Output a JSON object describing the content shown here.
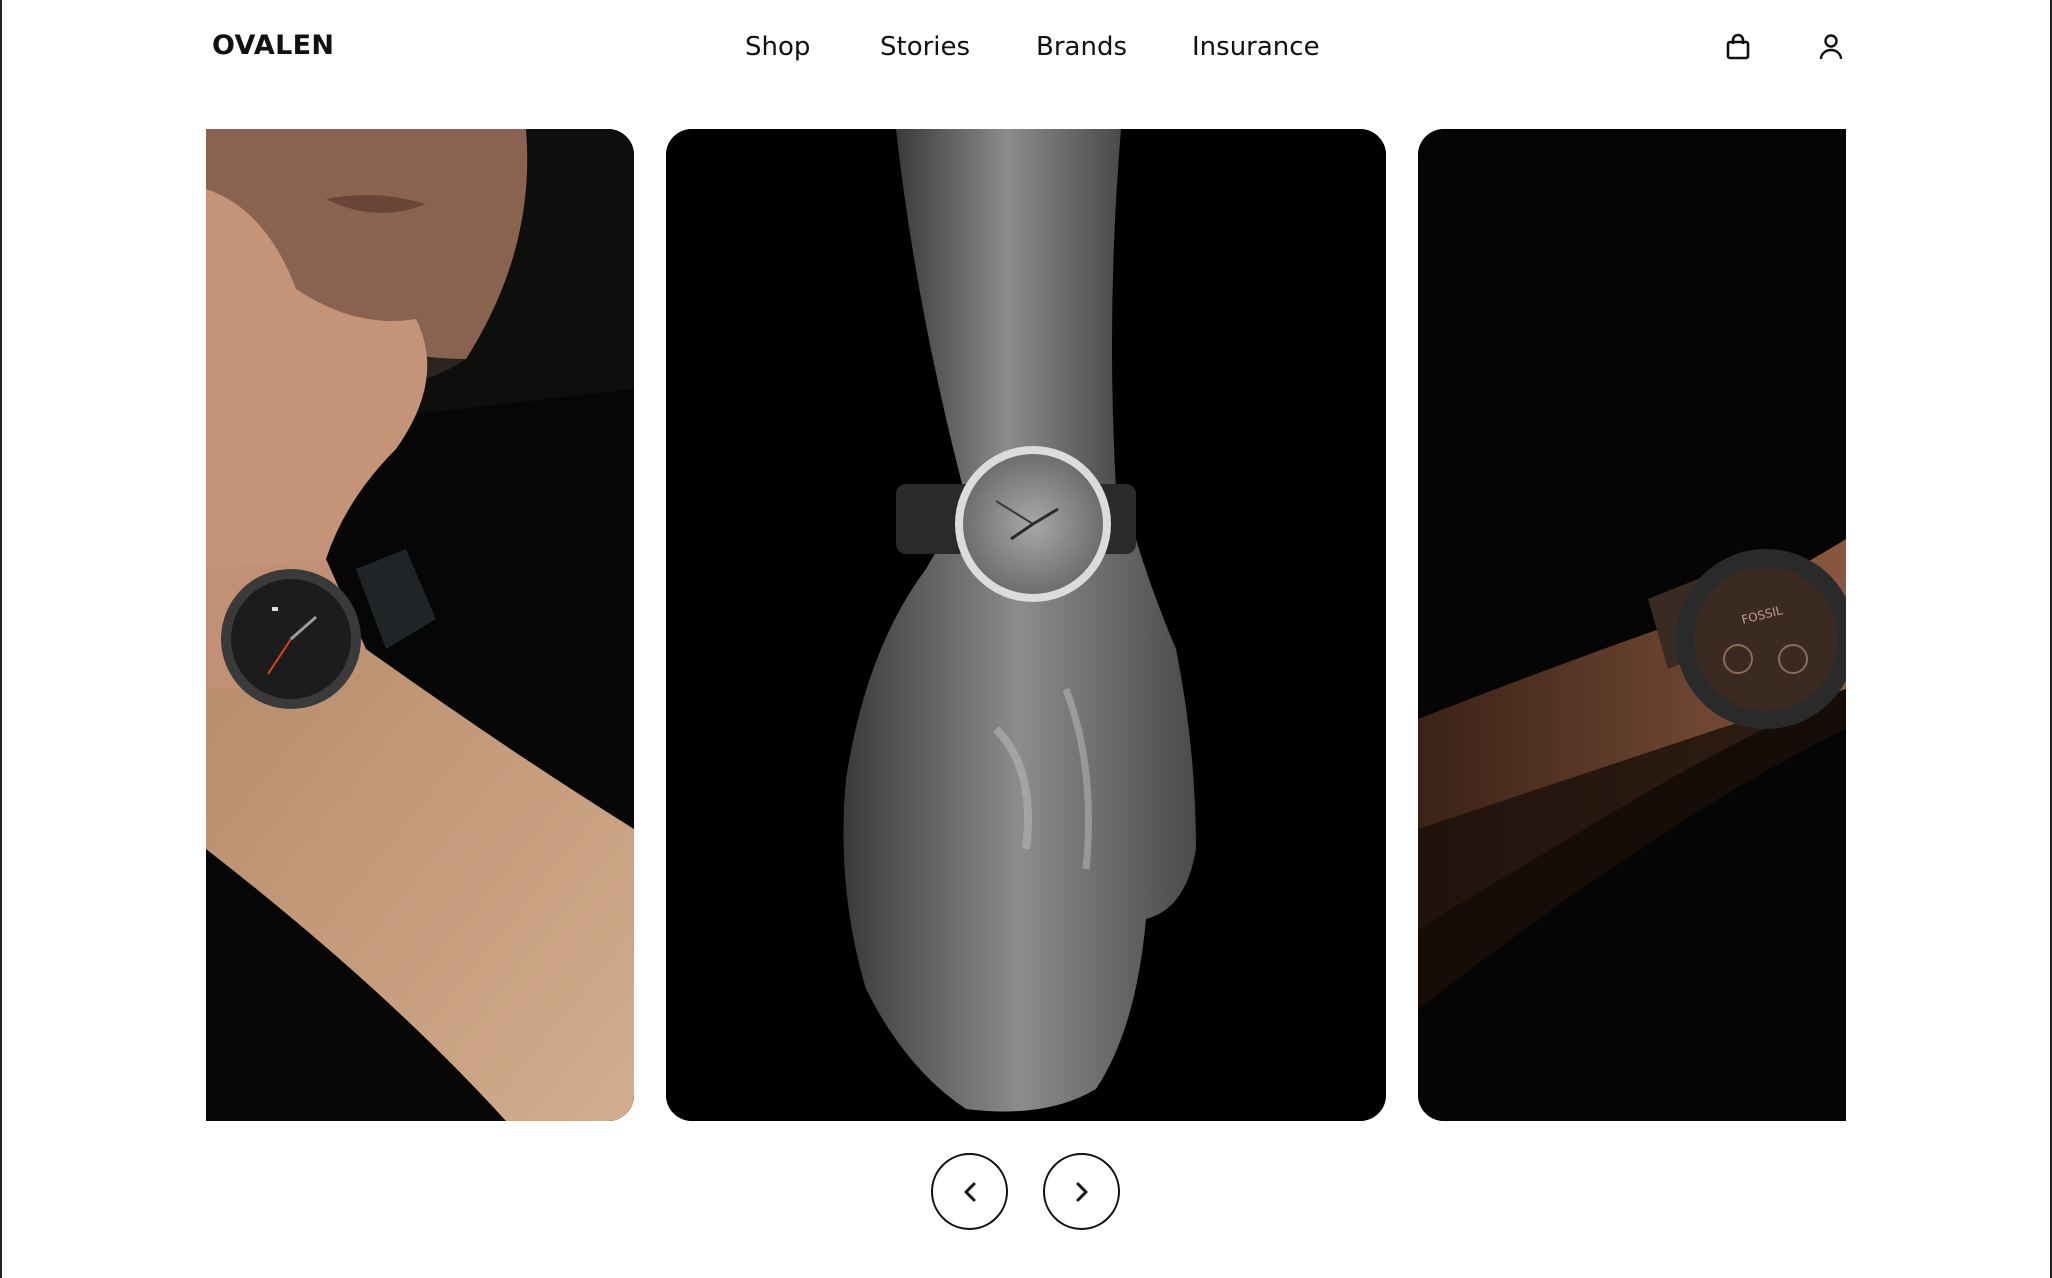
{
  "header": {
    "logo": "OVALEN",
    "nav": [
      {
        "label": "Shop"
      },
      {
        "label": "Stories"
      },
      {
        "label": "Brands"
      },
      {
        "label": "Insurance"
      }
    ],
    "icons": {
      "cart": "shopping-bag-icon",
      "account": "user-icon"
    }
  },
  "carousel": {
    "slides": [
      {
        "name": "slide-bearded-man-black-watch",
        "watch_brand_visible": ""
      },
      {
        "name": "slide-bw-wrist-silver-watch",
        "watch_brand_visible": ""
      },
      {
        "name": "slide-fossil-watch-dark",
        "watch_brand_visible": "FOSSIL"
      }
    ],
    "controls": {
      "prev": "chevron-left-icon",
      "next": "chevron-right-icon"
    }
  },
  "colors": {
    "background": "#ffffff",
    "text": "#111111",
    "card_bg": "#000000"
  }
}
